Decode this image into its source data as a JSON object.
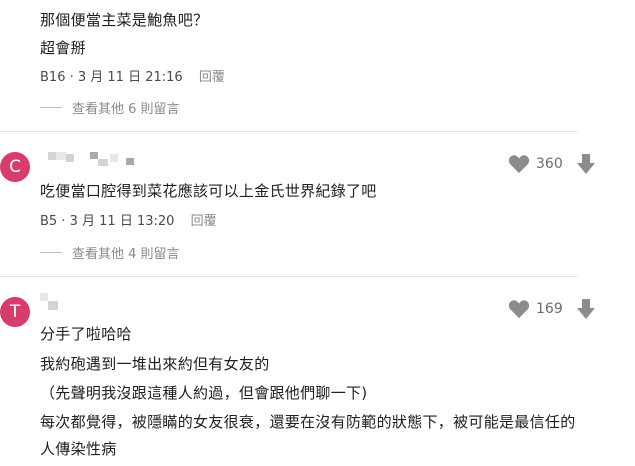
{
  "comments": [
    {
      "lines": [
        "那個便當主菜是鮑魚吧？",
        "超會掰"
      ],
      "floor": "B16",
      "date": "3 月 11 日 21:16",
      "reply_label": "回覆",
      "more_replies": "查看其他 6 則留言"
    },
    {
      "avatar_letter": "C",
      "likes": "360",
      "lines": [
        "吃便當口腔得到菜花應該可以上金氏世界紀錄了吧"
      ],
      "floor": "B5",
      "date": "3 月 11 日 13:20",
      "reply_label": "回覆",
      "more_replies": "查看其他 4 則留言"
    },
    {
      "avatar_letter": "T",
      "likes": "169",
      "lines": [
        "分手了啦哈哈",
        "我約砲遇到一堆出來約但有女友的",
        "（先聲明我沒跟這種人約過，但會跟他們聊一下)",
        "每次都覺得，被隱瞞的女友很衰，還要在沒有防範的狀態下，被可能是最信任的",
        "人傳染性病"
      ]
    }
  ],
  "colors": {
    "avatar": "#d63c6c",
    "icon": "#8c8c8c"
  },
  "icons": {
    "like": "heart-icon",
    "down": "down-arrow-icon"
  }
}
